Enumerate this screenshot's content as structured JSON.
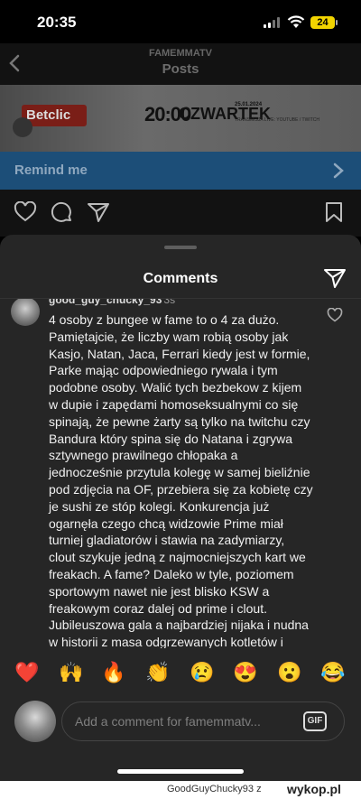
{
  "status_bar": {
    "time": "20:35",
    "battery": "24"
  },
  "post_header": {
    "username": "FAMEMMATV",
    "title": "Posts"
  },
  "banner": {
    "brand": "Betclic",
    "time": "20:00",
    "day": "CZWARTEK",
    "date": "25.01.2024",
    "small_text": "TRANSMISJA LIVE: YOUTUBE / TWITCH"
  },
  "remind": {
    "label": "Remind me"
  },
  "comments": {
    "title": "Comments",
    "items": [
      {
        "username": "good_guy_chucky_93",
        "time": "3s",
        "text": "4 osoby z bungee w fame to o 4 za dużo. Pamiętajcie, że liczby wam robią osoby jak Kasjo, Natan, Jaca, Ferrari kiedy jest w formie, Parke mając odpowiedniego rywala i tym podobne osoby. Walić tych bezbekow z kijem w dupie i zapędami homoseksualnymi co się spinają, że pewne żarty są tylko na twitchu czy Bandura który spina się do Natana i zgrywa sztywnego prawilnego chłopaka a jednocześnie przytula kolegę w samej bieliźnie pod zdjęcia na OF, przebiera się za kobietę czy je sushi ze stóp kolegi. Konkurencja już ogarnęła czego chcą widzowie Prime miał turniej gladiatorów i stawia na zadymiarzy, clout szykuje jedną z najmocniejszych kart we freakach. A fame? Daleko w tyle, poziomem sportowym nawet nie jest blisko KSW a freakowym coraz dalej od prime i clout. Jubileuszowa gala a najbardziej nijaka i nudna w historii z masa odgrzewanych kotletów i ratowaniu się pomysłami konkurencji"
      }
    ]
  },
  "emoji_bar": [
    "❤️",
    "🙌",
    "🔥",
    "👏",
    "😢",
    "😍",
    "😮",
    "😂"
  ],
  "composer": {
    "placeholder": "Add a comment for famemmatv...",
    "gif_label": "GIF"
  },
  "watermark": {
    "user": "GoodGuyChucky93",
    "z": "z",
    "site": "wykop.pl"
  },
  "colors": {
    "sheet_bg": "#262626",
    "remind_bar": "#1c4e78",
    "heart": "#e0245e"
  }
}
